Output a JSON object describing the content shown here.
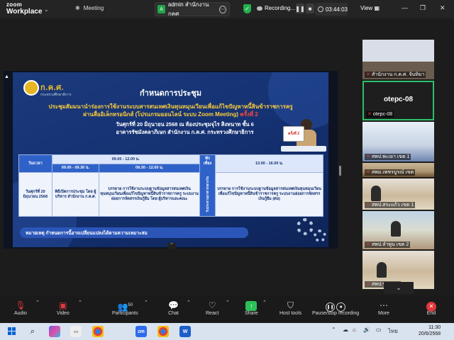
{
  "window": {
    "brand_line1": "zoom",
    "brand_line2": "Workplace",
    "meeting_tab": "Meeting",
    "admin_tab": "admin สำนักงาน กคศ",
    "admin_tab_icon": "A",
    "recording_label": "Recording...",
    "timer": "03:44:03",
    "view_label": "View"
  },
  "slide": {
    "logo_text": "ก.ค.ศ.",
    "logo_sub": "กระทรวงศึกษาธิการ",
    "title": "กำหนดการประชุม",
    "sub_line1": "ประชุมสัมมนานำร่องการใช้งานระบบสารสนเทศเงินทุนหมุนเวียนเพื่อแก้ไขปัญหาหนี้สินข้าราชการครู",
    "sub_line2": "ผ่านสื่ออิเล็กทรอนิกส์ (โปรแกรมออนไลน์ ระบบ Zoom Meeting)",
    "sub_line2_red": "ครั้งที่ 2",
    "date_line1": "วันศุกร์ที่ 20 มิถุนายน 2568 ณ ห้องประชุมจุไร สิงหนาท ชั้น 6",
    "date_line2": "อาคารรัชมังคลาภิเษก สำนักงาน ก.ค.ศ. กระทรวงศึกษาธิการ",
    "board_text": "ครั้งที่ 2",
    "table": {
      "col_date": "วัน/เวลา",
      "morning": "09.00 - 12.00 น.",
      "slot1": "09.00 - 09.30 น.",
      "slot2": "09.30 - 12.00 น.",
      "break_line1": "พัก",
      "break_line2": "เที่ยง",
      "afternoon": "13.00 - 16.00 น.",
      "date_cell": "วันศุกร์ที่ 20 มิถุนายน 2568",
      "slot1_cell": "พิธีเปิดการประชุม โดย ผู้บริหาร สำนักงาน ก.ค.ศ.",
      "slot2_cell": "บรรยาย การใช้งานระบบฐานข้อมูลสารสนเทศเงินทุนหมุนเวียนเพื่อแก้ไขปัญหาหนี้สินข้าราชการครู ระบบงานย่อยการจัดสรรเงินกู้ยืม โดย ผู้บริหารและคณะ",
      "break_cell": "รับประทานอาหารกลางวัน",
      "afternoon_cell": "บรรยาย การใช้งานระบบฐานข้อมูลสารสนเทศเงินทุนหมุนเวียนเพื่อแก้ไขปัญหาหนี้สินข้าราชการครู ระบบงานย่อยการจัดสรรเงินกู้ยืม (ต่อ)"
    },
    "note": "หมายเหตุ กำหนดการนี้อาจเปลี่ยนแปลงได้ตามความเหมาะสม"
  },
  "participants": [
    {
      "label": "สำนักงาน ก.ค.ศ. จันทิมา",
      "muted": true
    },
    {
      "label": "otepc-08",
      "big_name": "otepc-08",
      "muted": true,
      "active": true
    },
    {
      "label": "สพป.พะเยา เขต 1",
      "muted": true
    },
    {
      "label": "สพม.เพชรบูรณ์ เขต",
      "muted": true
    },
    {
      "label": "สพป.สระแก้ว เขต 1",
      "muted": true
    },
    {
      "label": "สพป.ลำพูน เขต 2",
      "muted": true
    },
    {
      "label": "สพป.ชุมพร 1",
      "muted": true
    }
  ],
  "toolbar": {
    "audio": "Audio",
    "video": "Video",
    "participants": "Participants",
    "participants_count": "50",
    "chat": "Chat",
    "react": "React",
    "share": "Share",
    "host_tools": "Host tools",
    "pause_stop": "Pause/stop recording",
    "more": "More",
    "end": "End"
  },
  "taskbar": {
    "zoom_app": "zm",
    "word_app": "W",
    "lang": "ไทย",
    "time": "11:30",
    "date": "20/6/2568"
  },
  "colors": {
    "accent_green": "#2dbf6c",
    "mute_red": "#e0383e",
    "slide_blue": "#1b3a7c",
    "title_yellow": "#ffcf3a"
  }
}
